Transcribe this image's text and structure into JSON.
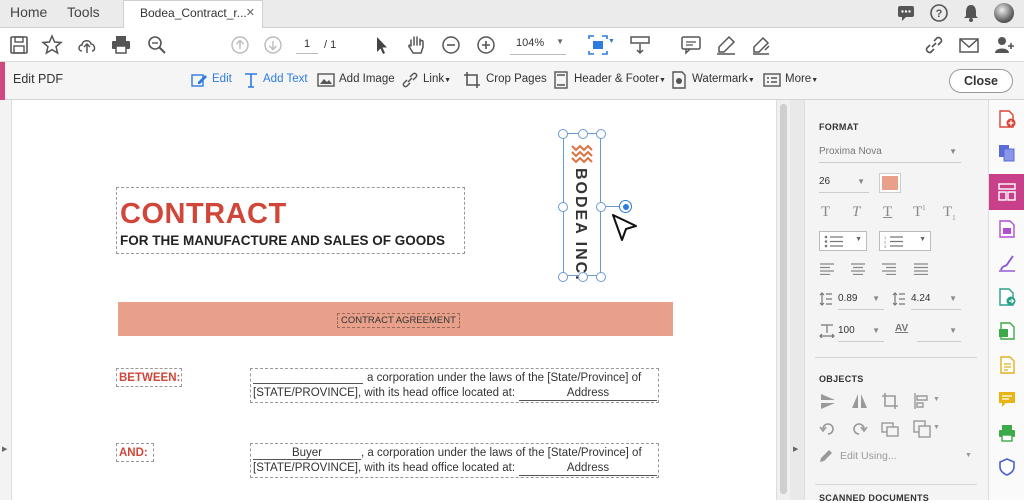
{
  "tabbar": {
    "home_label": "Home",
    "tools_label": "Tools",
    "document_tab_label": "Bodea_Contract_r...",
    "document_tab_close": "✕"
  },
  "toolbar": {
    "page_current": "1",
    "page_total": "/ 1",
    "zoom_value": "104%"
  },
  "edit_bar": {
    "title": "Edit PDF",
    "items": {
      "edit": "Edit",
      "add_text": "Add Text",
      "add_image": "Add Image",
      "link": "Link",
      "crop_pages": "Crop Pages",
      "header_footer": "Header & Footer",
      "watermark": "Watermark",
      "more": "More"
    },
    "close_label": "Close"
  },
  "document": {
    "title": "CONTRACT",
    "subtitle": "FOR THE MANUFACTURE AND SALES OF GOODS",
    "logo_text": "BODEA INC.",
    "banner": "CONTRACT AGREEMENT",
    "between_label": "BETWEEN:",
    "between_line1": "a corporation under the laws of the [State/Province] of",
    "between_line2_prefix": "[STATE/PROVINCE], with its head office located at:",
    "between_address": "Address",
    "and_label": "AND:",
    "and_buyer": "Buyer",
    "and_line1_suffix": ", a corporation under the laws of the [State/Province] of",
    "and_line2_prefix": "[STATE/PROVINCE], with its head office located at:",
    "and_address": "Address"
  },
  "format_panel": {
    "format_title": "FORMAT",
    "font_family": "Proxima Nova",
    "font_size": "26",
    "color_swatch": "#e8a08a",
    "line_spacing": "0.89",
    "paragraph_spacing": "4.24",
    "horizontal_scale": "100",
    "tracking_label": "AV",
    "objects_title": "OBJECTS",
    "edit_using_label": "Edit Using...",
    "scanned_title": "SCANNED DOCUMENTS"
  },
  "colors": {
    "accent": "#d1477f",
    "contract_red": "#d0473a",
    "banner_salmon": "#e8a08a",
    "blue": "#2d7be0"
  }
}
